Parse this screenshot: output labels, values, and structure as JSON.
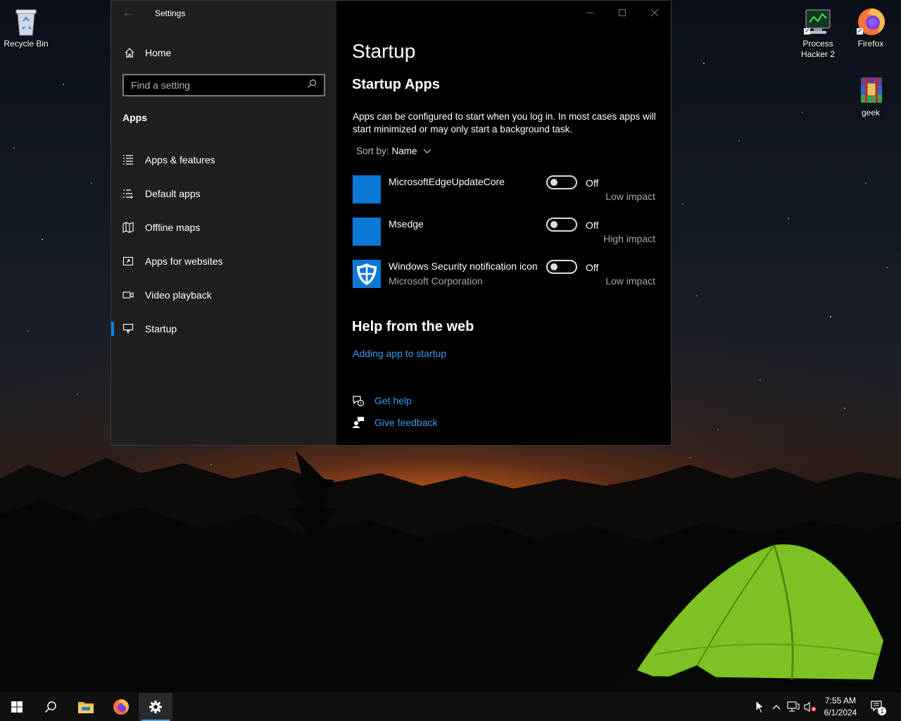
{
  "desktop": {
    "icons": [
      {
        "label": "Recycle Bin"
      },
      {
        "label": "Process Hacker 2"
      },
      {
        "label": "Firefox"
      },
      {
        "label": "geek"
      }
    ]
  },
  "window": {
    "title": "Settings",
    "nav": {
      "home": "Home",
      "search_placeholder": "Find a setting",
      "section": "Apps",
      "items": [
        {
          "label": "Apps & features",
          "icon": "list-icon"
        },
        {
          "label": "Default apps",
          "icon": "default-apps-icon"
        },
        {
          "label": "Offline maps",
          "icon": "map-icon"
        },
        {
          "label": "Apps for websites",
          "icon": "link-window-icon"
        },
        {
          "label": "Video playback",
          "icon": "video-icon"
        },
        {
          "label": "Startup",
          "icon": "startup-icon",
          "selected": true
        }
      ]
    },
    "main": {
      "title": "Startup",
      "subtitle": "Startup Apps",
      "description": "Apps can be configured to start when you log in. In most cases apps will start minimized or may only start a background task.",
      "sort_label": "Sort by:",
      "sort_value": "Name",
      "apps": [
        {
          "name": "MicrosoftEdgeUpdateCore",
          "publisher": "",
          "state": "Off",
          "impact": "Low impact",
          "icon": "blue-tile"
        },
        {
          "name": "Msedge",
          "publisher": "",
          "state": "Off",
          "impact": "High impact",
          "icon": "blue-tile"
        },
        {
          "name": "Windows Security notification icon",
          "publisher": "Microsoft Corporation",
          "state": "Off",
          "impact": "Low impact",
          "icon": "shield-icon"
        }
      ],
      "help_title": "Help from the web",
      "help_link": "Adding app to startup",
      "get_help": "Get help",
      "give_feedback": "Give feedback"
    }
  },
  "taskbar": {
    "time": "7:55 AM",
    "date": "6/1/2024",
    "notification_count": "1"
  },
  "colors": {
    "accent": "#0a78d7",
    "link": "#3a9bf0",
    "nav_bg": "#1f1f1f"
  }
}
